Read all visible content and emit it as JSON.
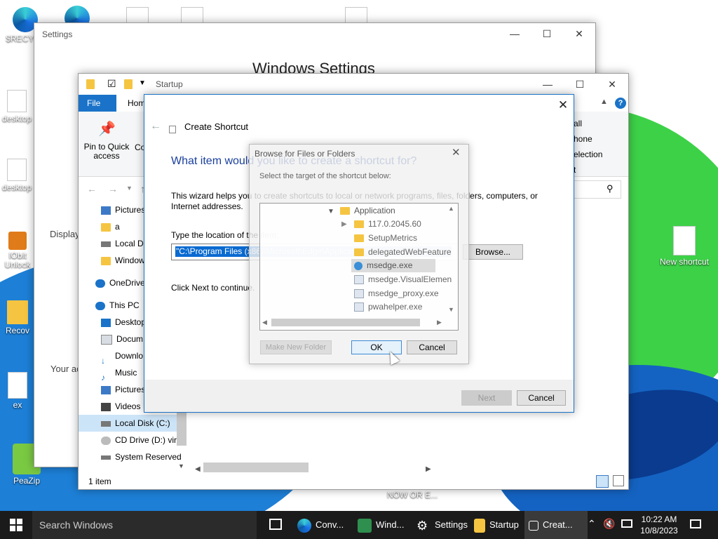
{
  "desktop": {
    "icons": [
      {
        "label": "$RECYCL"
      },
      {
        "label": "desktop"
      },
      {
        "label": "desktop"
      },
      {
        "label": "IObit Unlock"
      },
      {
        "label": "Recov"
      },
      {
        "label": "ex"
      },
      {
        "label": "PeaZip"
      },
      {
        "label": "New shortcut"
      }
    ],
    "bottom_text": "NOW OR E..."
  },
  "settings_window": {
    "title": "Settings",
    "heading": "Windows Settings",
    "side_text_1": "Display",
    "side_text_2": "Your ac"
  },
  "explorer": {
    "title": "Startup",
    "tabs": [
      "File",
      "Hom"
    ],
    "pin_label": "Pin to Quick access",
    "copy_label": "Co",
    "right_ribbon": [
      "all",
      "hone",
      "election",
      "t"
    ],
    "nav_items": [
      "Pictures",
      "a",
      "Local D",
      "Window",
      "OneDrive",
      "This PC",
      "Desktop",
      "Docum",
      "Downlo",
      "Music",
      "Pictures",
      "Videos",
      "Local Disk (C:)",
      "CD Drive (D:) virt",
      "System Reserved"
    ],
    "status": "1 item"
  },
  "wizard": {
    "title": "Create Shortcut",
    "question": "What item would you like to create a shortcut for?",
    "description": "This wizard helps you to create shortcuts to local or network programs, files, folders, computers, or Internet addresses.",
    "location_label": "Type the location of the item:",
    "location_value": "\"C:\\Program Files (x86)\\Microsoft\\Edge\\Application\\delegatedWebFeature",
    "browse_label": "Browse...",
    "continue_text": "Click Next to continue.",
    "next_label": "Next",
    "cancel_label": "Cancel"
  },
  "browse_dialog": {
    "title": "Browse for Files or Folders",
    "prompt": "Select the target of the shortcut below:",
    "tree": [
      {
        "label": "Application",
        "kind": "folder"
      },
      {
        "label": "117.0.2045.60",
        "kind": "folder"
      },
      {
        "label": "SetupMetrics",
        "kind": "folder"
      },
      {
        "label": "delegatedWebFeature",
        "kind": "folder"
      },
      {
        "label": "msedge.exe",
        "kind": "edge"
      },
      {
        "label": "msedge.VisualElemen",
        "kind": "file"
      },
      {
        "label": "msedge_proxy.exe",
        "kind": "exe"
      },
      {
        "label": "pwahelper.exe",
        "kind": "exe"
      }
    ],
    "new_folder_label": "Make New Folder",
    "ok_label": "OK",
    "cancel_label": "Cancel"
  },
  "taskbar": {
    "search_placeholder": "Search Windows",
    "apps": [
      "Conv...",
      "Wind...",
      "Settings",
      "Startup",
      "Creat..."
    ],
    "time": "10:22 AM",
    "date": "10/8/2023"
  }
}
